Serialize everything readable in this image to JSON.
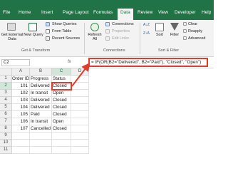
{
  "ribbon": {
    "tabs": [
      "File",
      "Home",
      "Insert",
      "Page Layout",
      "Formulas",
      "Data",
      "Review",
      "View",
      "Developer",
      "Help"
    ],
    "active_tab": "Data",
    "groups": [
      {
        "label": "Get & Transform"
      },
      {
        "label": "Connections"
      },
      {
        "label": "Sort & Filter"
      }
    ],
    "get_external_data": "Get External Data",
    "new_query": "New Query",
    "show_queries": "Show Queries",
    "from_table": "From Table",
    "recent_sources": "Recent Sources",
    "refresh_all": "Refresh All",
    "connections": "Connections",
    "properties": "Properties",
    "edit_links": "Edit Links",
    "sort": "Sort",
    "filter": "Filter",
    "clear": "Clear",
    "reapply": "Reapply",
    "advanced": "Advanced",
    "az": "A↓Z",
    "za": "Z↓A",
    "colors": {
      "accent": "#217346",
      "highlight": "#e23b2e"
    }
  },
  "formula_bar": {
    "name_box": "C2",
    "fx": "fx",
    "formula": "= IF(OR(B2=\"Delivered\", B2=\"Paid\"), \"Closed\", \"Open\")"
  },
  "sheet": {
    "columns": [
      "A",
      "B",
      "C",
      "D"
    ],
    "headers": [
      "Order ID",
      "Progress",
      "Status"
    ],
    "rows": [
      {
        "num": "1"
      },
      {
        "num": "2",
        "id": "101",
        "progress": "Delivered",
        "status": "Closed"
      },
      {
        "num": "3",
        "id": "102",
        "progress": "In transit",
        "status": "Open"
      },
      {
        "num": "4",
        "id": "103",
        "progress": "Delivered",
        "status": "Closed"
      },
      {
        "num": "5",
        "id": "104",
        "progress": "Delivered",
        "status": "Closed"
      },
      {
        "num": "6",
        "id": "105",
        "progress": "Paid",
        "status": "Closed"
      },
      {
        "num": "7",
        "id": "106",
        "progress": "In transit",
        "status": "Open"
      },
      {
        "num": "8",
        "id": "107",
        "progress": "Cancelled",
        "status": "Closed"
      },
      {
        "num": "9"
      },
      {
        "num": "10"
      },
      {
        "num": "11"
      }
    ]
  }
}
